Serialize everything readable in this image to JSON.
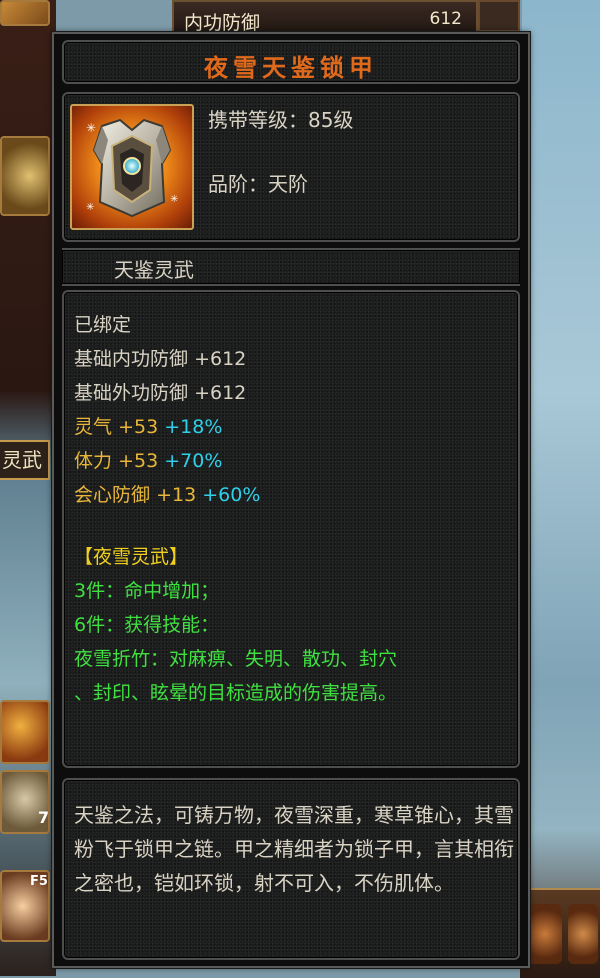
{
  "background": {
    "top_stat": {
      "label": "内功防御",
      "value": "612"
    },
    "side_tab": "灵武",
    "hotkey": "F5",
    "stack_count": "7"
  },
  "item": {
    "name": "夜雪天鉴锁甲",
    "icon": "armor-chestplate-icon",
    "level_line": "携带等级：85级",
    "grade_line": "品阶：天阶",
    "category": "天鉴灵武"
  },
  "stats": {
    "bound": "已绑定",
    "base": [
      {
        "name": "基础内功防御",
        "value": "+612"
      },
      {
        "name": "基础外功防御",
        "value": "+612"
      }
    ],
    "bonus": [
      {
        "name": "灵气",
        "value": "+53",
        "pct": "+18%"
      },
      {
        "name": "体力",
        "value": "+53",
        "pct": "+70%"
      },
      {
        "name": "会心防御",
        "value": "+13",
        "pct": "+60%"
      }
    ],
    "set_name": "【夜雪灵武】",
    "set_3": "3件：命中增加；",
    "set_6": "6件：获得技能：",
    "skill_line1": "夜雪折竹：对麻痹、失明、散功、封穴",
    "skill_line2": "、封印、眩晕的目标造成的伤害提高。"
  },
  "description": "天鉴之法，可铸万物，夜雪深重，寒草锥心，其雪粉飞于锁甲之链。甲之精细者为锁子甲，言其相衔之密也，铠如环锁，射不可入，不伤肌体。",
  "colors": {
    "title": "#e06a1c",
    "text": "#d9d3c4",
    "stat_value": "#e8b63a",
    "percent": "#2fd0ea",
    "set_text": "#3fe040",
    "set_name": "#f0d020"
  }
}
